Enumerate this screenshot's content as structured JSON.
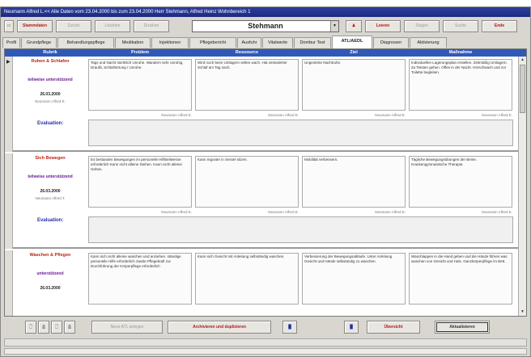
{
  "window": {
    "title": "Neumann Alfred L.<< Alle Daten vom 23.04.2000 bis zum 23.04.2000    Herr Stehmann, Alfred Heinz Wohnbereich 1"
  },
  "toolbar": {
    "buttons": [
      {
        "label": "Stammdaten",
        "style": "red"
      },
      {
        "label": "Zurück",
        "style": "gray"
      },
      {
        "label": "Löschen",
        "style": "gray"
      },
      {
        "label": "Drucken",
        "style": "gray"
      }
    ],
    "resident_select": "Stehmann",
    "right_buttons": [
      {
        "label": "",
        "style": "icon"
      },
      {
        "label": "Leeren",
        "style": "red"
      },
      {
        "label": "Zeigen",
        "style": "gray"
      },
      {
        "label": "Suche",
        "style": "gray"
      },
      {
        "label": "Ende",
        "style": "red"
      }
    ]
  },
  "tabs": [
    "Profil",
    "Grundpflege",
    "Behandlungspflege",
    "Medikation",
    "Injektionen",
    "Pflegebericht",
    "Ausfuhr",
    "Vitalwerte",
    "Dombur Test",
    "ATL/AEDL",
    "Diagnosen",
    "Aktivierung"
  ],
  "active_tab": "ATL/AEDL",
  "grid": {
    "columns": [
      "Rubrik",
      "Problem",
      "Ressource",
      "Ziel",
      "Maßnahme"
    ],
    "evaluation_label": "Evaluation:",
    "records": [
      {
        "rubrik": "Ruhen & Schlafen",
        "status": "teilweise unterstützend",
        "date": "26.03.2000",
        "author": "Neumann Alfred E.",
        "problem": "Tags und Nacht nächtlich Unruhe. Wandern sehr unruhig, Draußt, Schlafstörung / Unruhe.",
        "ressource": "Wird noch beim Umlagern selten wach. Hat veränderter Schlaf am Tag nach.",
        "ziel": "Ungestörte Nachtruhe.",
        "massnahme": "Individuellen Lagerungsplan erstellen. Zeitmäßig Umlagern. Zu Tetsten gehen. Offen in der Nacht. Hörschwach und zur Toilette begleiten.",
        "cell_author": "Neumann Alfred E."
      },
      {
        "rubrik": "Sich Bewegen",
        "status": "teilweise unterstützend",
        "date": "26.03.2000",
        "author": "Neumann Alfred T.",
        "problem": "Es bestanden Bewegungen im personelle Hilfsteilwesse erforderlich Kann nicht alleine Stehen. Kann nicht alleine Gehen.",
        "ressource": "Kann Inguster in Sessel sitzen.",
        "ziel": "Mobilität verbessern.",
        "massnahme": "Tägliche Bewegungsübungen der Beine. Krankengymnastische Therapie.",
        "cell_author": "Neumann Alfred E."
      },
      {
        "rubrik": "Waschen & Pflegen",
        "status": "unterstützend",
        "date": "26.03.2000",
        "author": "",
        "problem": "Kann sich nicht alleine waschen und anziehen. ständige personelle Hilfe erforderlich zweite Pflegekraft zur Durchführung der Körperpflege erforderlich",
        "ressource": "Kann sich Gesicht mit Anleitung selbständig waschen.",
        "ziel": "Verbesserung der Bewegungsabläufe. Unter Anleitung Gesicht und Hände selbständig zu waschen.",
        "massnahme": "Waschlappen in die Hand geben und die Hände führen was waschen von Gesicht und Hals. Ganzkörperpflege im Bett.",
        "cell_author": ""
      }
    ]
  },
  "bottom": {
    "buttons": [
      {
        "label": "Neue ATL anlegen",
        "style": "gray"
      },
      {
        "label": "Archivieren und duplizieren",
        "style": "red"
      },
      {
        "label": "Übersicht",
        "style": "red"
      },
      {
        "label": "Aktualisieren",
        "style": "outlined"
      }
    ]
  }
}
